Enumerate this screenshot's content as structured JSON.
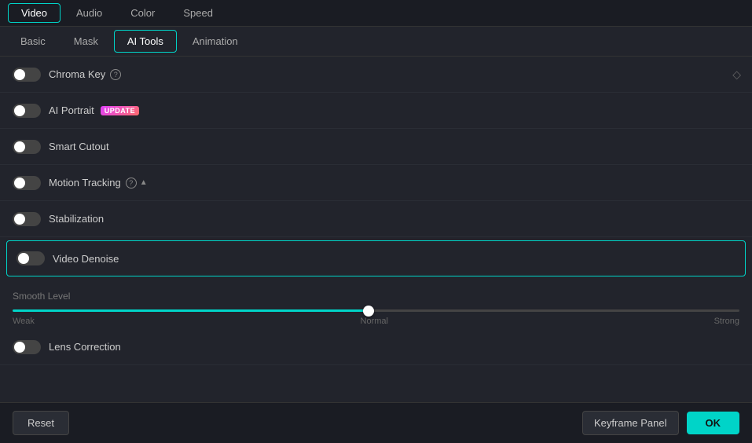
{
  "top_tabs": {
    "items": [
      {
        "label": "Video",
        "active": true
      },
      {
        "label": "Audio",
        "active": false
      },
      {
        "label": "Color",
        "active": false
      },
      {
        "label": "Speed",
        "active": false
      }
    ]
  },
  "sub_tabs": {
    "items": [
      {
        "label": "Basic",
        "active": false
      },
      {
        "label": "Mask",
        "active": false
      },
      {
        "label": "AI Tools",
        "active": true
      },
      {
        "label": "Animation",
        "active": false
      }
    ]
  },
  "settings": [
    {
      "id": "chroma-key",
      "label": "Chroma Key",
      "on": false,
      "help": true,
      "diamond": true,
      "badge": null,
      "highlighted": false
    },
    {
      "id": "ai-portrait",
      "label": "AI Portrait",
      "on": false,
      "help": false,
      "diamond": false,
      "badge": "UPDATE",
      "highlighted": false
    },
    {
      "id": "smart-cutout",
      "label": "Smart Cutout",
      "on": false,
      "help": false,
      "diamond": false,
      "badge": null,
      "highlighted": false
    },
    {
      "id": "motion-tracking",
      "label": "Motion Tracking",
      "on": false,
      "help": true,
      "diamond": false,
      "badge": null,
      "highlighted": false,
      "chevron": true
    },
    {
      "id": "stabilization",
      "label": "Stabilization",
      "on": false,
      "help": false,
      "diamond": false,
      "badge": null,
      "highlighted": false
    },
    {
      "id": "video-denoise",
      "label": "Video Denoise",
      "on": false,
      "help": false,
      "diamond": false,
      "badge": null,
      "highlighted": true
    }
  ],
  "smooth_level": {
    "label": "Smooth Level",
    "min_label": "Weak",
    "mid_label": "Normal",
    "max_label": "Strong",
    "value": 49
  },
  "lens_correction": {
    "label": "Lens Correction",
    "on": false
  },
  "bottom": {
    "reset_label": "Reset",
    "keyframe_label": "Keyframe Panel",
    "ok_label": "OK"
  }
}
